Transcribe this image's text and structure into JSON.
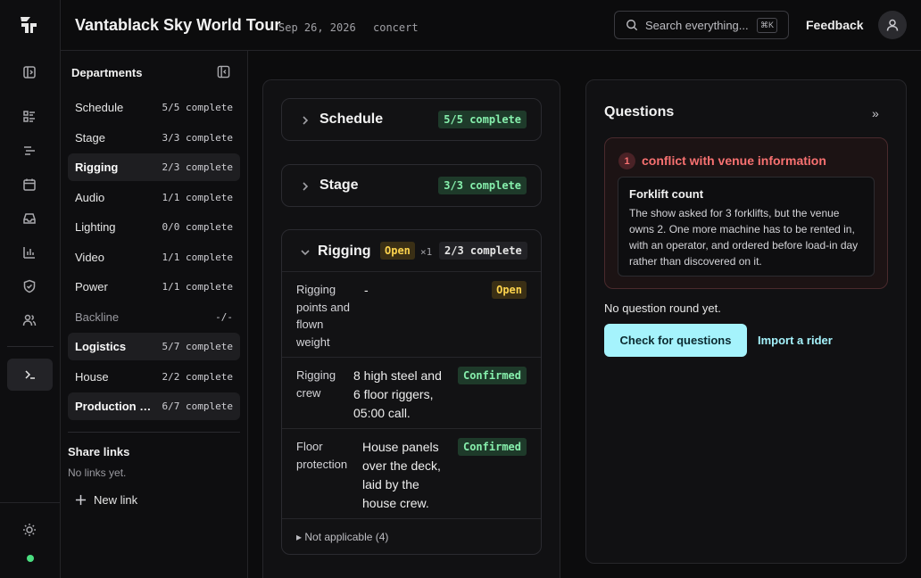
{
  "header": {
    "title": "Vantablack Sky World Tour",
    "date": "Sep 26, 2026",
    "event_type": "concert",
    "search_placeholder": "Search everything...",
    "search_shortcut": "⌘K",
    "feedback_label": "Feedback"
  },
  "departments": {
    "heading": "Departments",
    "items": [
      {
        "name": "Schedule",
        "status": "5/5 complete",
        "active": false,
        "muted": false
      },
      {
        "name": "Stage",
        "status": "3/3 complete",
        "active": false,
        "muted": false
      },
      {
        "name": "Rigging",
        "status": "2/3 complete",
        "active": true,
        "muted": false
      },
      {
        "name": "Audio",
        "status": "1/1 complete",
        "active": false,
        "muted": false
      },
      {
        "name": "Lighting",
        "status": "0/0 complete",
        "active": false,
        "muted": false
      },
      {
        "name": "Video",
        "status": "1/1 complete",
        "active": false,
        "muted": false
      },
      {
        "name": "Power",
        "status": "1/1 complete",
        "active": false,
        "muted": false
      },
      {
        "name": "Backline",
        "status": "-/-",
        "active": false,
        "muted": true
      },
      {
        "name": "Logistics",
        "status": "5/7 complete",
        "active": true,
        "muted": false
      },
      {
        "name": "House",
        "status": "2/2 complete",
        "active": false,
        "muted": false
      },
      {
        "name": "Production …",
        "status": "6/7 complete",
        "active": true,
        "muted": false
      }
    ],
    "share_links_heading": "Share links",
    "share_links_empty": "No links yet.",
    "new_link_label": "New link"
  },
  "sections": {
    "schedule": {
      "title": "Schedule",
      "status": "5/5 complete"
    },
    "stage": {
      "title": "Stage",
      "status": "3/3 complete"
    },
    "rigging": {
      "title": "Rigging",
      "open_badge": "Open",
      "count": "×1",
      "status": "2/3 complete",
      "rows": [
        {
          "label": "Rigging\npoints and\nflown\nweight",
          "value": "-",
          "badge": "Open"
        },
        {
          "label": "Rigging\ncrew",
          "value": "8 high steel and\n6 floor riggers,\n05:00 call.",
          "badge": "Confirmed"
        },
        {
          "label": "Floor\nprotection",
          "value": "House panels\nover the deck,\nlaid by the\nhouse crew.",
          "badge": "Confirmed"
        }
      ],
      "not_applicable": "▸ Not applicable (4)"
    }
  },
  "questions": {
    "title": "Questions",
    "expand_glyph": "»",
    "conflict": {
      "count": "1",
      "title": "conflict with venue information",
      "card_title": "Forklift count",
      "card_body": "The show asked for 3 forklifts, but the venue owns 2. One more machine has to be rented in, with an operator, and ordered before load-in day rather than discovered on it."
    },
    "no_round": "No question round yet.",
    "check_label": "Check for questions",
    "import_label": "Import a rider"
  },
  "colors": {
    "accent": "#a5f3fc",
    "success": "#86efac",
    "warning": "#fcd34d",
    "danger": "#f87171",
    "online": "#4ade80"
  },
  "icons": {
    "rail": [
      "logo-icon",
      "sidebar-toggle-icon",
      "list-icon",
      "timeline-icon",
      "calendar-icon",
      "inbox-icon",
      "chart-icon",
      "shield-icon",
      "users-icon",
      "terminal-icon",
      "sun-icon"
    ]
  }
}
